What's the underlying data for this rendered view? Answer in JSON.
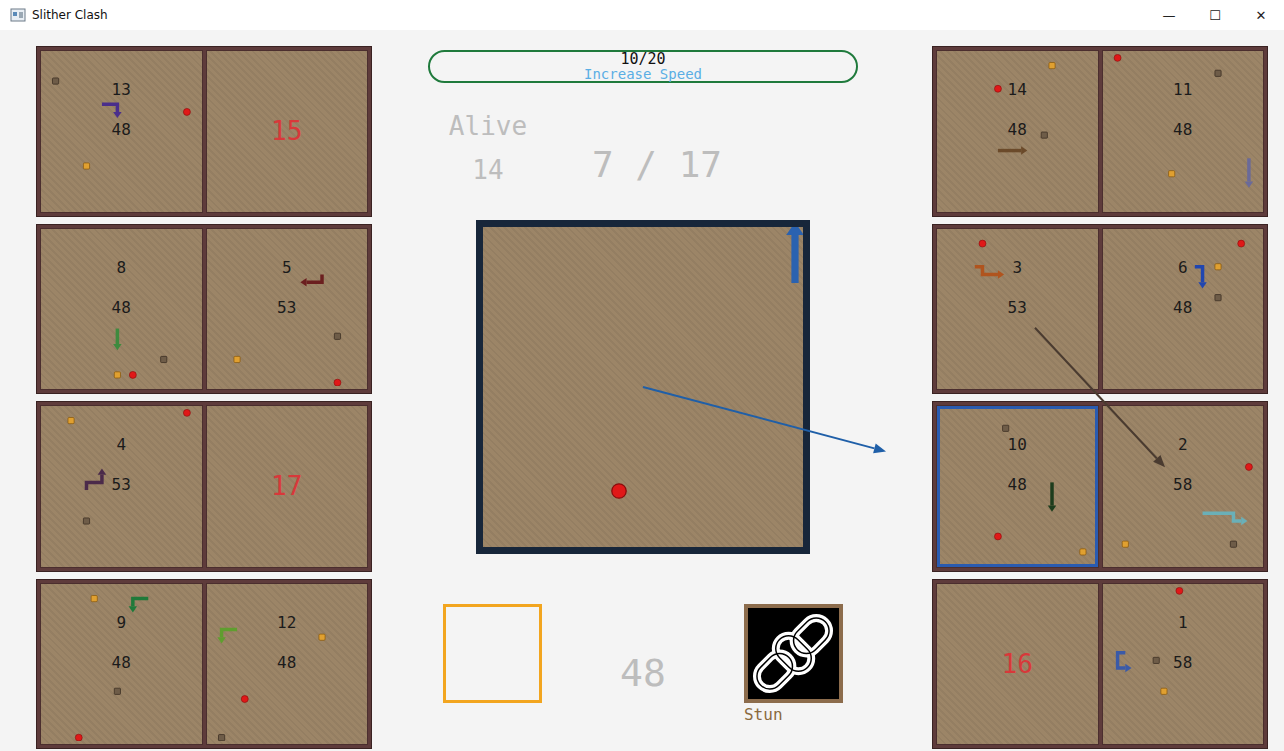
{
  "window": {
    "title": "Slither Clash",
    "controls": [
      "—",
      "☐",
      "✕"
    ]
  },
  "progress": {
    "value": "10/20",
    "label": "Increase Speed",
    "level": 0
  },
  "alive": {
    "label": "Alive",
    "count": "14"
  },
  "score": "7 / 17",
  "length": "48",
  "item_slot": {
    "empty": true
  },
  "ability": {
    "label": "Stun"
  },
  "my_board": {
    "snake": {
      "color": "#2a62b0",
      "body": [
        [
          19,
          3
        ],
        [
          19,
          2
        ],
        [
          19,
          1
        ],
        [
          19,
          0
        ]
      ]
    },
    "items": [
      {
        "kind": "apple",
        "x": 8,
        "y": 16
      }
    ]
  },
  "left_boards": [
    {
      "player": "13",
      "length": "48",
      "dead": false,
      "targeted": false,
      "snake": {
        "color": "#4a2e8c",
        "body": [
          [
            7,
            6
          ],
          [
            8,
            6
          ],
          [
            9,
            6
          ],
          [
            9,
            7
          ]
        ]
      },
      "items": [
        {
          "kind": "rock",
          "x": 1,
          "y": 3
        },
        {
          "kind": "apple",
          "x": 18,
          "y": 7
        },
        {
          "kind": "orange",
          "x": 5,
          "y": 14
        }
      ]
    },
    {
      "player": "15",
      "dead": true,
      "targeted": false
    },
    {
      "player": "8",
      "length": "48",
      "dead": false,
      "targeted": false,
      "snake": {
        "color": "#3e8a3e",
        "body": [
          [
            9,
            12
          ],
          [
            9,
            13
          ],
          [
            9,
            14
          ]
        ]
      },
      "items": [
        {
          "kind": "rock",
          "x": 15,
          "y": 16
        },
        {
          "kind": "orange",
          "x": 9,
          "y": 18
        },
        {
          "kind": "apple",
          "x": 11,
          "y": 18
        }
      ]
    },
    {
      "player": "5",
      "length": "53",
      "dead": false,
      "targeted": false,
      "snake": {
        "color": "#6b1f1f",
        "body": [
          [
            14,
            5
          ],
          [
            14,
            6
          ],
          [
            13,
            6
          ],
          [
            12,
            6
          ]
        ]
      },
      "items": [
        {
          "kind": "rock",
          "x": 16,
          "y": 13
        },
        {
          "kind": "orange",
          "x": 3,
          "y": 16
        },
        {
          "kind": "apple",
          "x": 16,
          "y": 19
        }
      ]
    },
    {
      "player": "4",
      "length": "53",
      "dead": false,
      "targeted": false,
      "snake": {
        "color": "#4b2a4a",
        "body": [
          [
            5,
            10
          ],
          [
            5,
            9
          ],
          [
            6,
            9
          ],
          [
            7,
            9
          ],
          [
            7,
            8
          ]
        ]
      },
      "items": [
        {
          "kind": "orange",
          "x": 3,
          "y": 1
        },
        {
          "kind": "apple",
          "x": 18,
          "y": 0
        },
        {
          "kind": "rock",
          "x": 5,
          "y": 14
        }
      ]
    },
    {
      "player": "17",
      "dead": true,
      "targeted": false
    },
    {
      "player": "9",
      "length": "48",
      "dead": false,
      "targeted": false,
      "snake": {
        "color": "#1f7a3a",
        "body": [
          [
            13,
            1
          ],
          [
            12,
            1
          ],
          [
            11,
            1
          ],
          [
            11,
            2
          ]
        ]
      },
      "items": [
        {
          "kind": "orange",
          "x": 6,
          "y": 1
        },
        {
          "kind": "rock",
          "x": 9,
          "y": 13
        },
        {
          "kind": "apple",
          "x": 4,
          "y": 19
        }
      ]
    },
    {
      "player": "12",
      "length": "48",
      "dead": false,
      "targeted": false,
      "snake": {
        "color": "#5f9e2f",
        "body": [
          [
            3,
            5
          ],
          [
            2,
            5
          ],
          [
            1,
            5
          ],
          [
            1,
            6
          ]
        ]
      },
      "items": [
        {
          "kind": "orange",
          "x": 14,
          "y": 6
        },
        {
          "kind": "apple",
          "x": 4,
          "y": 14
        },
        {
          "kind": "rock",
          "x": 1,
          "y": 19
        }
      ]
    }
  ],
  "right_boards": [
    {
      "player": "14",
      "length": "48",
      "dead": false,
      "targeted": false,
      "snake": {
        "color": "#6b4a2a",
        "body": [
          [
            7,
            12
          ],
          [
            8,
            12
          ],
          [
            9,
            12
          ],
          [
            10,
            12
          ]
        ]
      },
      "items": [
        {
          "kind": "orange",
          "x": 14,
          "y": 1
        },
        {
          "kind": "apple",
          "x": 7,
          "y": 4
        },
        {
          "kind": "rock",
          "x": 13,
          "y": 10
        }
      ]
    },
    {
      "player": "11",
      "length": "48",
      "dead": false,
      "targeted": false,
      "snake": {
        "color": "#6a6a9a",
        "body": [
          [
            18,
            13
          ],
          [
            18,
            14
          ],
          [
            18,
            15
          ],
          [
            18,
            16
          ]
        ]
      },
      "items": [
        {
          "kind": "apple",
          "x": 1,
          "y": 0
        },
        {
          "kind": "rock",
          "x": 14,
          "y": 2
        },
        {
          "kind": "orange",
          "x": 8,
          "y": 15
        }
      ]
    },
    {
      "player": "3",
      "length": "53",
      "dead": false,
      "targeted": false,
      "snake": {
        "color": "#b0541e",
        "body": [
          [
            4,
            4
          ],
          [
            5,
            4
          ],
          [
            5,
            5
          ],
          [
            6,
            5
          ],
          [
            7,
            5
          ]
        ]
      },
      "items": [
        {
          "kind": "apple",
          "x": 5,
          "y": 1
        }
      ]
    },
    {
      "player": "6",
      "length": "48",
      "dead": false,
      "targeted": false,
      "snake": {
        "color": "#2046b0",
        "body": [
          [
            11,
            4
          ],
          [
            12,
            4
          ],
          [
            12,
            5
          ],
          [
            12,
            6
          ]
        ]
      },
      "items": [
        {
          "kind": "apple",
          "x": 17,
          "y": 1
        },
        {
          "kind": "orange",
          "x": 14,
          "y": 4
        },
        {
          "kind": "rock",
          "x": 14,
          "y": 8
        }
      ]
    },
    {
      "player": "10",
      "length": "48",
      "dead": false,
      "targeted": true,
      "snake": {
        "color": "#1d3d1d",
        "body": [
          [
            14,
            9
          ],
          [
            14,
            10
          ],
          [
            14,
            11
          ],
          [
            14,
            12
          ]
        ]
      },
      "items": [
        {
          "kind": "rock",
          "x": 8,
          "y": 2
        },
        {
          "kind": "apple",
          "x": 7,
          "y": 16
        },
        {
          "kind": "orange",
          "x": 18,
          "y": 18
        }
      ]
    },
    {
      "player": "2",
      "length": "58",
      "dead": false,
      "targeted": false,
      "snake": {
        "color": "#6ab0b8",
        "body": [
          [
            12,
            13
          ],
          [
            13,
            13
          ],
          [
            14,
            13
          ],
          [
            15,
            13
          ],
          [
            16,
            13
          ],
          [
            16,
            14
          ],
          [
            17,
            14
          ]
        ]
      },
      "items": [
        {
          "kind": "apple",
          "x": 18,
          "y": 7
        },
        {
          "kind": "orange",
          "x": 2,
          "y": 17
        },
        {
          "kind": "rock",
          "x": 16,
          "y": 17
        }
      ]
    },
    {
      "player": "16",
      "dead": true,
      "targeted": false
    },
    {
      "player": "1",
      "length": "58",
      "dead": false,
      "targeted": false,
      "snake": {
        "color": "#3a5aa8",
        "body": [
          [
            2,
            8
          ],
          [
            1,
            8
          ],
          [
            1,
            9
          ],
          [
            1,
            10
          ],
          [
            2,
            10
          ]
        ]
      },
      "items": [
        {
          "kind": "apple",
          "x": 9,
          "y": 0
        },
        {
          "kind": "rock",
          "x": 6,
          "y": 9
        },
        {
          "kind": "orange",
          "x": 7,
          "y": 13
        }
      ]
    }
  ],
  "arrows": [
    {
      "from": "me",
      "to": "10",
      "color": "#1f5fa8"
    },
    {
      "from": "3",
      "to": "2",
      "color": "#4a3b30"
    }
  ]
}
